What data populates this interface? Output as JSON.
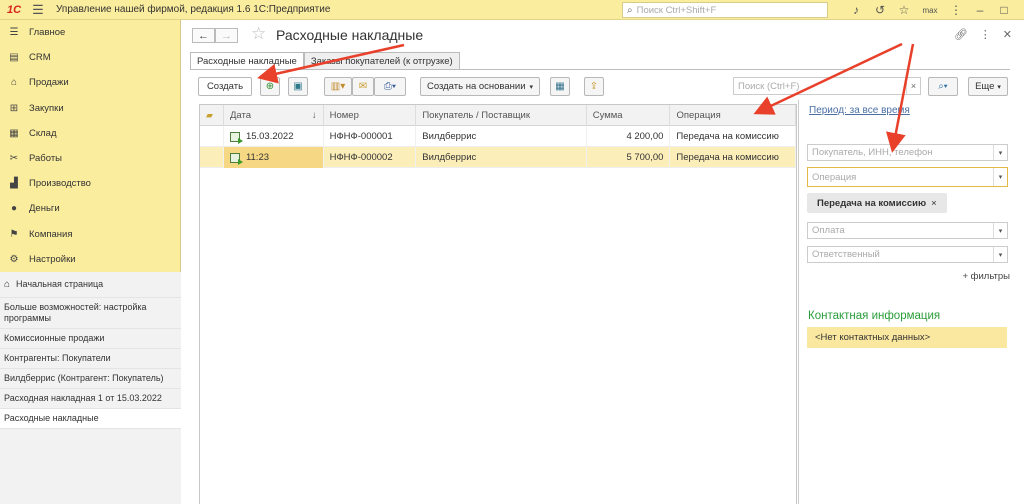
{
  "titlebar": {
    "logo": "1С",
    "title": "Управление нашей фирмой, редакция 1.6 1С:Предприятие",
    "search_placeholder": "Поиск Ctrl+Shift+F",
    "user": "max"
  },
  "sidebar": {
    "sections": [
      {
        "label": "Главное",
        "icon": "menu-lines-icon",
        "glyph": "☰"
      },
      {
        "label": "CRM",
        "icon": "crm-icon",
        "glyph": "▤"
      },
      {
        "label": "Продажи",
        "icon": "shop-icon",
        "glyph": "⌂"
      },
      {
        "label": "Закупки",
        "icon": "cart-icon",
        "glyph": "⊞"
      },
      {
        "label": "Склад",
        "icon": "grid-icon",
        "glyph": "▦"
      },
      {
        "label": "Работы",
        "icon": "tools-icon",
        "glyph": "✂"
      },
      {
        "label": "Производство",
        "icon": "factory-icon",
        "glyph": "▟"
      },
      {
        "label": "Деньги",
        "icon": "coin-icon",
        "glyph": "●"
      },
      {
        "label": "Компания",
        "icon": "flag-icon",
        "glyph": "⚑"
      },
      {
        "label": "Настройки",
        "icon": "gear-icon",
        "glyph": "⚙"
      }
    ],
    "history": {
      "home": "Начальная страница",
      "items": [
        "Больше возможностей: настройка программы",
        "Комиссионные продажи",
        "Контрагенты: Покупатели",
        "Вилдберрис (Контрагент: Покупатель)",
        "Расходная накладная 1 от 15.03.2022",
        "Расходные накладные"
      ]
    }
  },
  "main": {
    "title": "Расходные накладные",
    "tabs": [
      "Расходные накладные",
      "Заказы покупателей (к отгрузке)"
    ],
    "toolbar": {
      "create": "Создать",
      "create_based": "Создать на основании",
      "search_placeholder": "Поиск (Ctrl+F)",
      "more": "Еще"
    },
    "table": {
      "columns": [
        "",
        "Дата",
        "Номер",
        "Покупатель / Поставщик",
        "Сумма",
        "Операция"
      ],
      "rows": [
        {
          "date": "15.03.2022",
          "number": "НФНФ-000001",
          "partner": "Вилдберрис",
          "sum": "4 200,00",
          "operation": "Передача на комиссию"
        },
        {
          "date": "11:23",
          "number": "НФНФ-000002",
          "partner": "Вилдберрис",
          "sum": "5 700,00",
          "operation": "Передача на комиссию"
        }
      ]
    }
  },
  "filters": {
    "period": "Период: за все время",
    "partner_placeholder": "Покупатель, ИНН, телефон",
    "operation_placeholder": "Операция",
    "chip": "Передача на комиссию",
    "payment_placeholder": "Оплата",
    "responsible_placeholder": "Ответственный",
    "more_filters": "+ фильтры",
    "contact_title": "Контактная информация",
    "contact_value": "<Нет контактных данных>"
  },
  "colors": {
    "sidebar_bg": "#fbed9e",
    "selected_row": "#fbeeb9",
    "arrow": "#e8402a",
    "contact_green": "#2a9d3a"
  }
}
